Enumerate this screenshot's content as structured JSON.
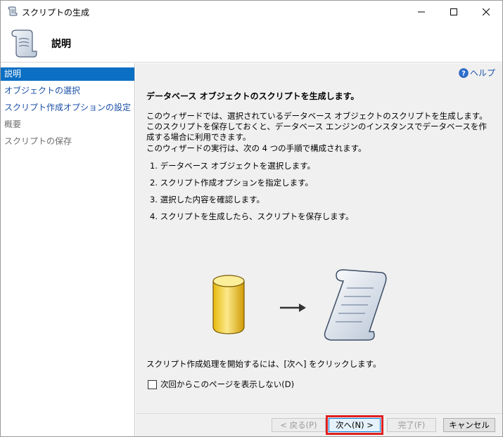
{
  "window": {
    "title": "スクリプトの生成",
    "icons": {
      "app": "script-scroll-icon",
      "minimize": "minimize-icon",
      "maximize": "maximize-icon",
      "close": "close-icon"
    }
  },
  "header": {
    "title": "説明",
    "icon": "script-scroll-icon"
  },
  "sidebar": {
    "items": [
      {
        "label": "説明",
        "state": "selected"
      },
      {
        "label": "オブジェクトの選択",
        "state": "link"
      },
      {
        "label": "スクリプト作成オプションの設定",
        "state": "link"
      },
      {
        "label": "概要",
        "state": "disabled"
      },
      {
        "label": "スクリプトの保存",
        "state": "disabled"
      }
    ]
  },
  "main": {
    "help_label": "ヘルプ",
    "heading": "データベース オブジェクトのスクリプトを生成します。",
    "description": "このウィザードでは、選択されているデータベース オブジェクトのスクリプトを生成します。このスクリプトを保存しておくと、データベース エンジンのインスタンスでデータベースを作成する場合に利用できます。",
    "steps_intro": "このウィザードの実行は、次の 4 つの手順で構成されます。",
    "steps": [
      "1. データベース オブジェクトを選択します。",
      "2. スクリプト作成オプションを指定します。",
      "3. 選択した内容を確認します。",
      "4. スクリプトを生成したら、スクリプトを保存します。"
    ],
    "footer_text": "スクリプト作成処理を開始するには、[次へ] をクリックします。",
    "skip_checkbox_label": "次回からこのページを表示しない(D)",
    "skip_checkbox_checked": false
  },
  "buttons": {
    "back": "< 戻る(P)",
    "next": "次へ(N) >",
    "finish": "完了(F)",
    "cancel": "キャンセル"
  },
  "colors": {
    "selection": "#0b6fc4",
    "link": "#1a4fa8",
    "highlight": "#e02020"
  }
}
